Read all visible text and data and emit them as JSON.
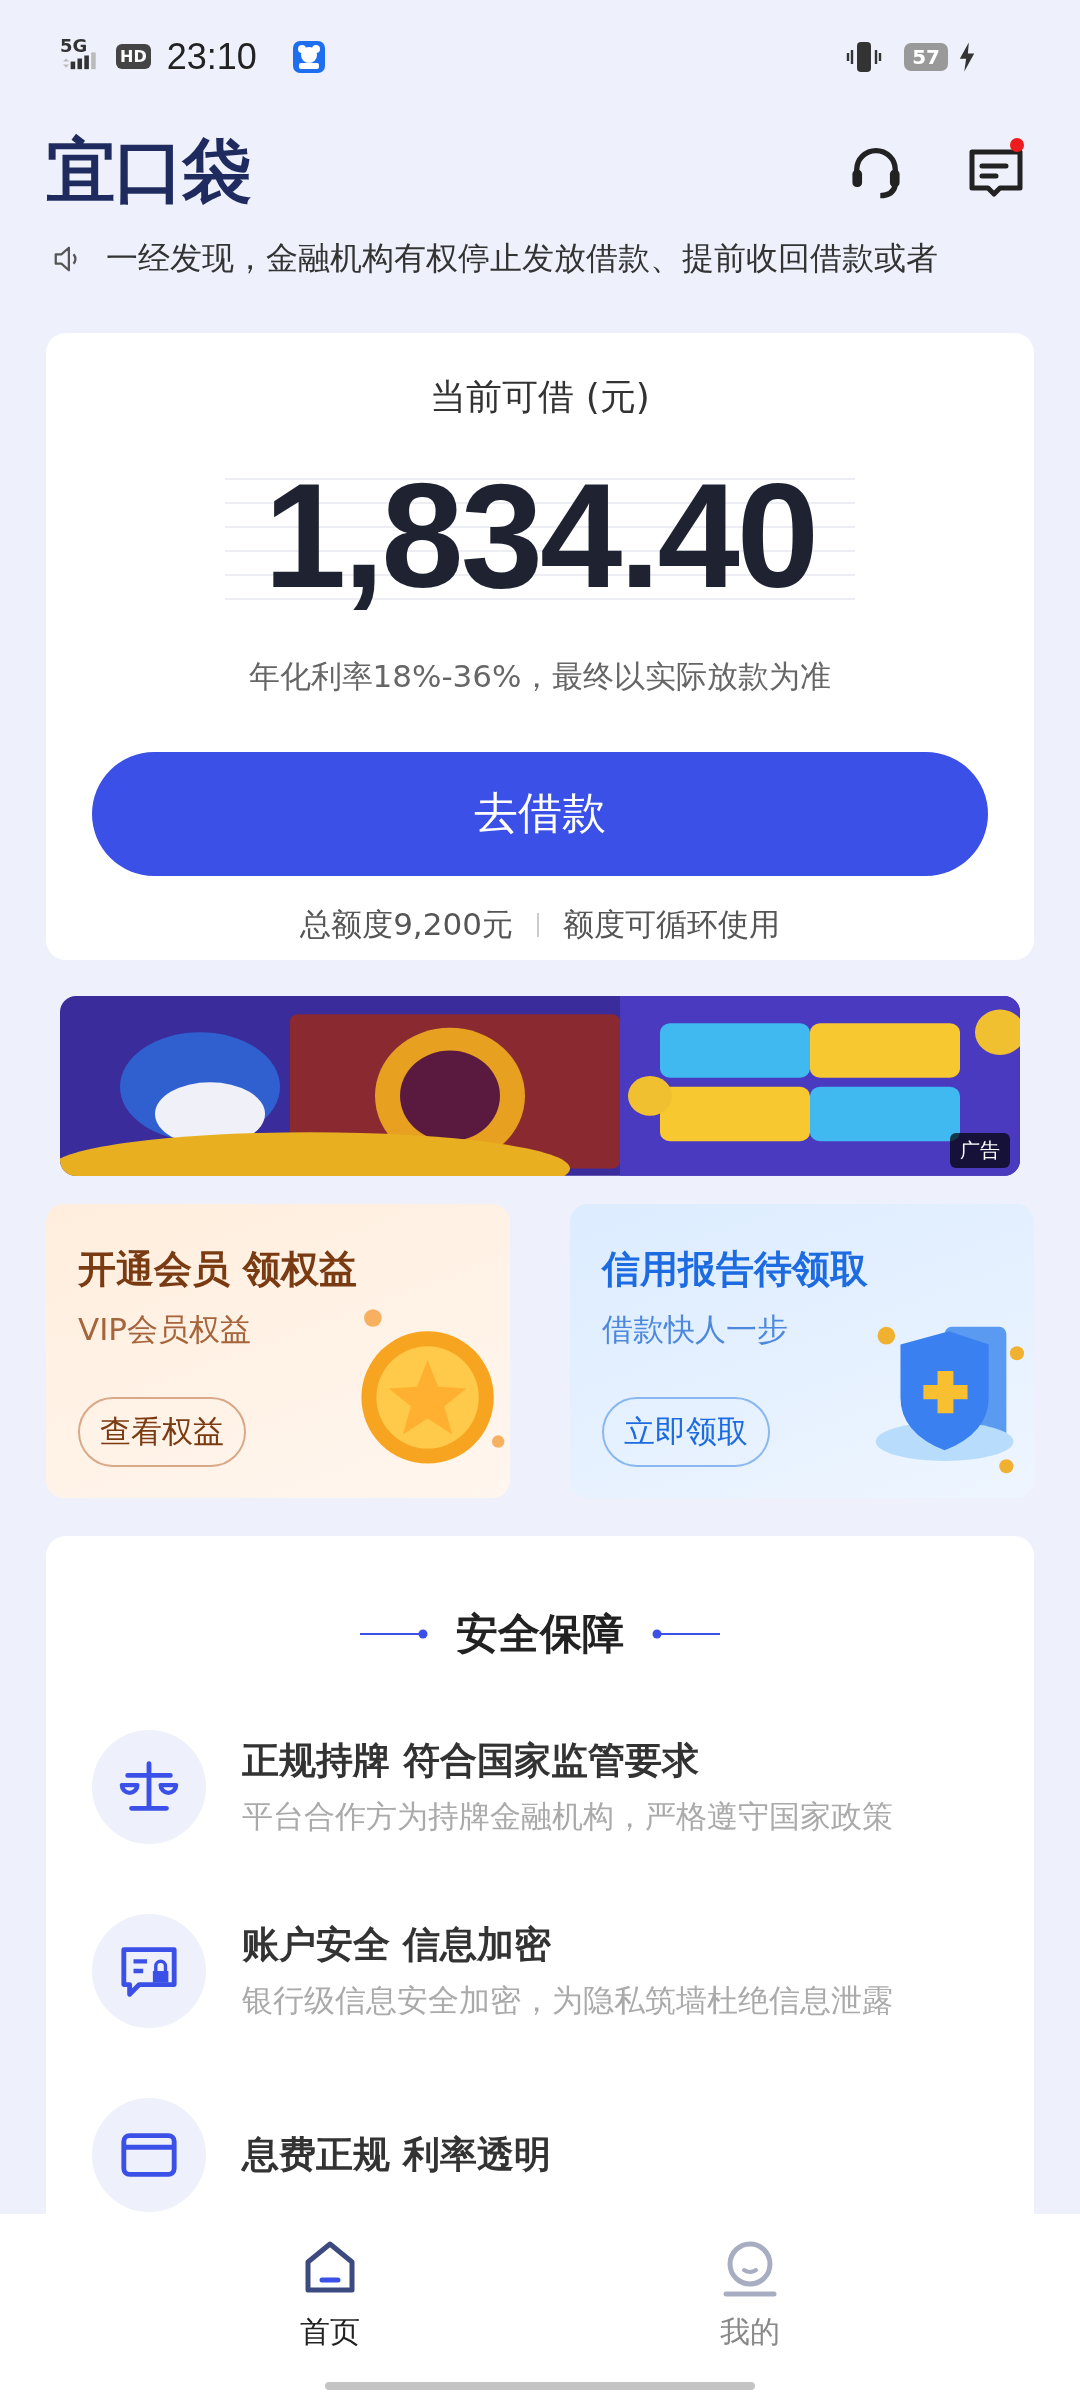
{
  "status_bar": {
    "network": "5G",
    "hd": "HD",
    "time": "23:10",
    "battery": "57"
  },
  "header": {
    "logo": "宜口袋",
    "messages_unread": true
  },
  "notice": {
    "text": "一经发现，金融机构有权停止发放借款、提前收回借款或者"
  },
  "loan_card": {
    "label": "当前可借 (元)",
    "amount": "1,834.40",
    "rate": "年化利率18%-36%，最终以实际放款为准",
    "button": "去借款",
    "total": "总额度9,200元",
    "note": "额度可循环使用"
  },
  "ad_banner": {
    "kind": "picture",
    "tag": "广告"
  },
  "promo_cards": [
    {
      "kind": "vip",
      "title": "开通会员 领权益",
      "subtitle": "VIP会员权益",
      "button": "查看权益"
    },
    {
      "kind": "credit",
      "title": "信用报告待领取",
      "subtitle": "借款快人一步",
      "button": "立即领取"
    }
  ],
  "security": {
    "title": "安全保障",
    "items": [
      {
        "kind": "license",
        "title": "正规持牌 符合国家监管要求",
        "subtitle": "平台合作方为持牌金融机构，严格遵守国家政策"
      },
      {
        "kind": "privacy",
        "title": "账户安全 信息加密",
        "subtitle": "银行级信息安全加密，为隐私筑墙杜绝信息泄露"
      },
      {
        "kind": "fees",
        "title": "息费正规 利率透明"
      }
    ]
  },
  "tab_bar": [
    {
      "kind": "home",
      "label": "首页",
      "selected": true
    },
    {
      "kind": "mine",
      "label": "我的",
      "selected": false
    }
  ]
}
